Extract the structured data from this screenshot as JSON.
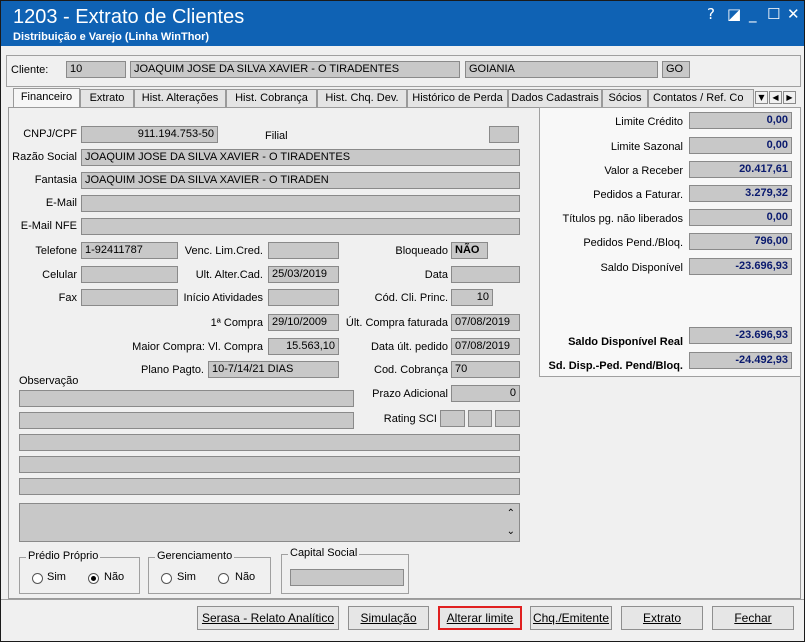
{
  "window": {
    "title": "1203 - Extrato de Clientes",
    "subtitle": "Distribuição e Varejo (Linha WinThor)",
    "controls": [
      "?",
      "◪",
      "_",
      "☐",
      "✕"
    ]
  },
  "client": {
    "label": "Cliente:",
    "code": "10",
    "name": "JOAQUIM JOSE DA SILVA XAVIER - O TIRADENTES",
    "city": "GOIANIA",
    "state": "GO"
  },
  "tabs": [
    "Financeiro",
    "Extrato",
    "Hist. Alterações",
    "Hist. Cobrança",
    "Hist. Chq. Dev.",
    "Histórico de Perda",
    "Dados Cadastrais",
    "Sócios",
    "Contatos / Ref. Co"
  ],
  "form": {
    "cnpj_label": "CNPJ/CPF",
    "cnpj": "911.194.753-50",
    "filial_label": "Filial",
    "filial": "",
    "razao_label": "Razão Social",
    "razao": "JOAQUIM JOSE DA SILVA XAVIER - O TIRADENTES",
    "fantasia_label": "Fantasia",
    "fantasia": "JOAQUIM JOSE DA SILVA XAVIER - O TIRADEN",
    "email_label": "E-Mail",
    "email": "",
    "emailnfe_label": "E-Mail NFE",
    "emailnfe": "",
    "telefone_label": "Telefone",
    "telefone": "1-92411787",
    "venc_label": "Venc. Lim.Cred.",
    "venc": "",
    "bloqueado_label": "Bloqueado",
    "bloqueado": "NÃO",
    "celular_label": "Celular",
    "celular": "",
    "ultalter_label": "Ult. Alter.Cad.",
    "ultalter": "25/03/2019",
    "data_label": "Data",
    "data": "",
    "fax_label": "Fax",
    "fax": "",
    "inicio_label": "Início Atividades",
    "inicio": "",
    "codprinc_label": "Cód. Cli. Princ.",
    "codprinc": "10",
    "primeira_label": "1ª Compra",
    "primeira": "29/10/2009",
    "ultcompra_label": "Últ. Compra faturada",
    "ultcompra": "07/08/2019",
    "maior_label": "Maior Compra: Vl. Compra",
    "maior": "15.563,10",
    "dataped_label": "Data últ. pedido",
    "dataped": "07/08/2019",
    "plano_label": "Plano Pagto.",
    "plano": "10-7/14/21 DIAS",
    "cobranca_label": "Cod. Cobrança",
    "cobranca": "70",
    "obs_label": "Observação",
    "prazo_label": "Prazo Adicional",
    "prazo": "0",
    "rating_label": "Rating SCI"
  },
  "summary": {
    "limite_credito_label": "Limite Crédito",
    "limite_credito": "0,00",
    "limite_sazonal_label": "Limite Sazonal",
    "limite_sazonal": "0,00",
    "valor_receber_label": "Valor a Receber",
    "valor_receber": "20.417,61",
    "pedidos_faturar_label": "Pedidos a Faturar.",
    "pedidos_faturar": "3.279,32",
    "titulos_label": "Títulos pg. não liberados",
    "titulos": "0,00",
    "pedidos_pend_label": "Pedidos Pend./Bloq.",
    "pedidos_pend": "796,00",
    "saldo_disp_label": "Saldo Disponível",
    "saldo_disp": "-23.696,93",
    "saldo_real_label": "Saldo Disponível Real",
    "saldo_real": "-23.696,93",
    "sd_disp_label": "Sd. Disp.-Ped. Pend/Bloq.",
    "sd_disp": "-24.492,93"
  },
  "groups": {
    "predio_label": "Prédio Próprio",
    "gerenciamento_label": "Gerenciamento",
    "capital_label": "Capital Social",
    "sim": "Sim",
    "nao": "Não"
  },
  "buttons": {
    "serasa": "Serasa - Relato Analítico",
    "simulacao": "Simulação",
    "alterar": "Alterar limite",
    "chq": "Chq./Emitente",
    "extrato": "Extrato",
    "fechar": "Fechar"
  },
  "colors": {
    "titlebar": "#0f62b4",
    "highlight": "#e02020",
    "value_blue": "#0a1a6e"
  }
}
